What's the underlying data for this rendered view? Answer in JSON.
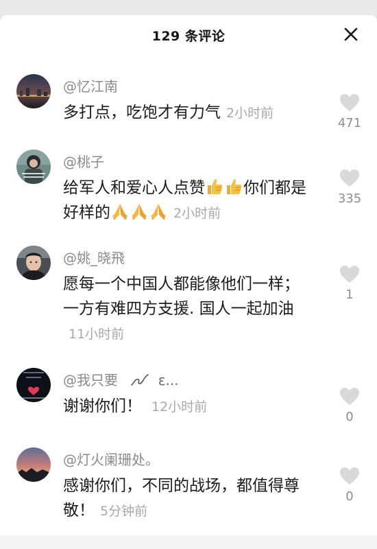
{
  "header": {
    "title": "129 条评论",
    "close_icon": "close-icon"
  },
  "comments": [
    {
      "username": "@忆江南",
      "text": "多打点，吃饱才有力气",
      "time": "2小时前",
      "likes": "471",
      "avatar": "night-city-avatar"
    },
    {
      "username": "@桃子",
      "text_part1": "给军人和爱心人点赞",
      "text_part2": "你们都是好样的",
      "time": "2小时前",
      "likes": "335",
      "avatar": "girl-photo-avatar",
      "emojis": [
        "thumbs-up-emoji",
        "folded-hands-emoji"
      ]
    },
    {
      "username": "@姚_晓飛",
      "text": "愿每一个中国人都能像他们一样；一方有难四方支援. 国人一起加油",
      "time": "11小时前",
      "likes": "1",
      "avatar": "man-selfie-avatar"
    },
    {
      "username": "@我只要",
      "username_suffix": "ε...",
      "text": "谢谢你们！",
      "time": "12小时前",
      "likes": "0",
      "avatar": "dark-text-avatar"
    },
    {
      "username": "@灯火阑珊处。",
      "text": "感谢你们，不同的战场，都值得尊敬！",
      "time": "5分钟前",
      "likes": "0",
      "avatar": "sunset-avatar"
    }
  ],
  "colors": {
    "background": "#ffffff",
    "username": "#8a8a8a",
    "text": "#1c1c1c",
    "time": "#a8a8a8",
    "heart": "#d6d6d6"
  }
}
